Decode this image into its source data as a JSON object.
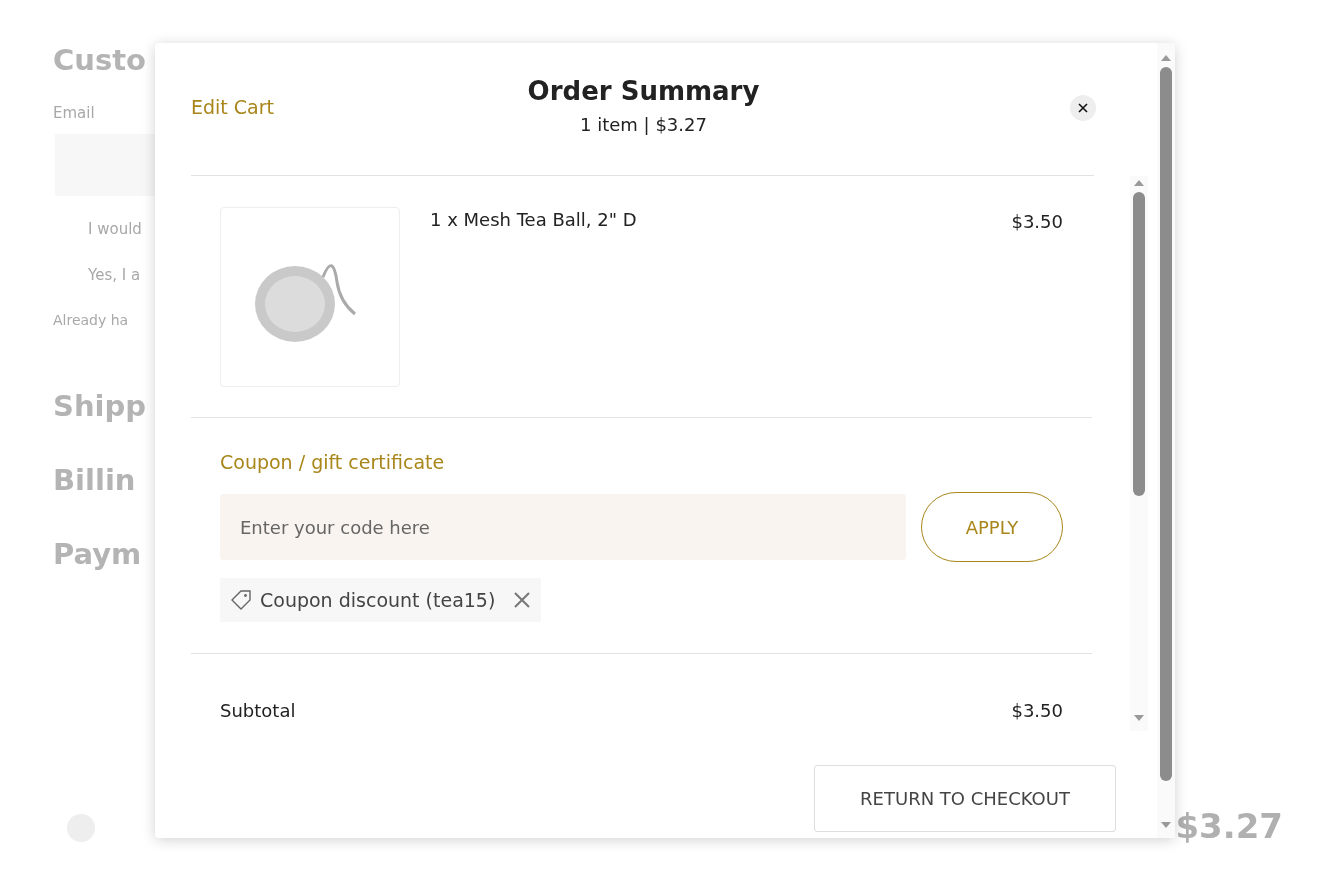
{
  "background": {
    "items": [
      {
        "kind": "heading",
        "text": "Custo"
      },
      {
        "kind": "label",
        "text": "Email"
      },
      {
        "kind": "field"
      },
      {
        "kind": "option",
        "text": "I would"
      },
      {
        "kind": "option",
        "text": "Yes, I a"
      },
      {
        "kind": "note",
        "text": "Already ha"
      },
      {
        "kind": "heading",
        "text": "Shipp"
      },
      {
        "kind": "heading",
        "text": "Billin"
      },
      {
        "kind": "heading",
        "text": "Paym"
      }
    ],
    "total": "$3.27"
  },
  "modal": {
    "edit_link": "Edit Cart",
    "title": "Order Summary",
    "subtitle": "1 item | $3.27",
    "items": [
      {
        "name": "1 x Mesh Tea Ball, 2\" D",
        "price": "$3.50"
      }
    ],
    "coupon": {
      "label": "Coupon / gift certificate",
      "placeholder": "Enter your code here",
      "button": "APPLY",
      "applied": "Coupon discount (tea15)"
    },
    "totals": [
      {
        "label": "Subtotal",
        "value": "$3.50"
      }
    ],
    "return_button": "RETURN TO CHECKOUT"
  }
}
